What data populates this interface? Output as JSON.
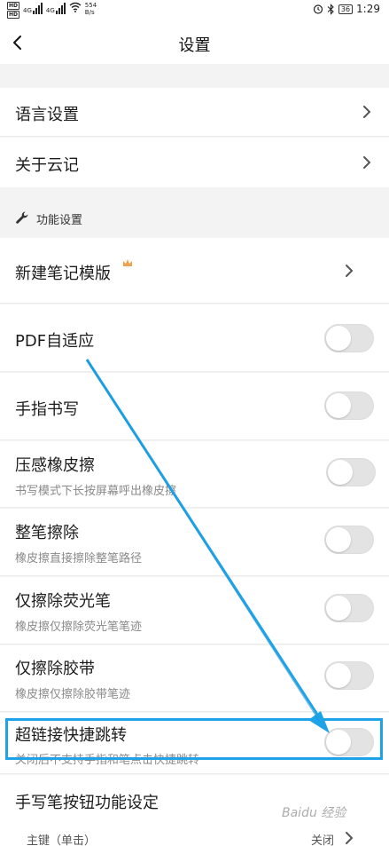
{
  "status_bar": {
    "hd1": "HD",
    "hd2": "HD",
    "signal1": "4G",
    "signal2": "4G",
    "speed_value": "554",
    "speed_unit": "B/s",
    "battery": "36",
    "time": "1:29"
  },
  "header": {
    "title": "设置"
  },
  "general": {
    "language": "语言设置",
    "about": "关于云记"
  },
  "section": {
    "title": "功能设置"
  },
  "items": {
    "new_note_template": "新建笔记模版",
    "pdf_adaptive": "PDF自适应",
    "finger_writing": "手指书写",
    "pressure_eraser": "压感橡皮擦",
    "pressure_eraser_sub": "书写模式下长按屏幕呼出橡皮擦",
    "whole_stroke_erase": "整笔擦除",
    "whole_stroke_erase_sub": "橡皮擦直接擦除整笔路径",
    "erase_highlighter": "仅擦除荧光笔",
    "erase_highlighter_sub": "橡皮擦仅擦除荧光笔笔迹",
    "erase_tape": "仅擦除胶带",
    "erase_tape_sub": "橡皮擦仅擦除胶带笔迹",
    "hyperlink_jump": "超链接快捷跳转",
    "hyperlink_jump_sub": "关闭后不支持手指和笔点击快捷跳转",
    "pen_button": "手写笔按钮功能设定",
    "primary_key": "主键（单击）",
    "primary_key_value": "关闭"
  },
  "watermark": "Baidu 经验",
  "colors": {
    "accent_arrow": "#1ea3e8",
    "toggle_off": "#e3e3e3",
    "crown": "#f0a04a"
  },
  "icons": [
    "back-arrow-icon",
    "chevron-right-icon",
    "wrench-icon",
    "crown-icon"
  ]
}
